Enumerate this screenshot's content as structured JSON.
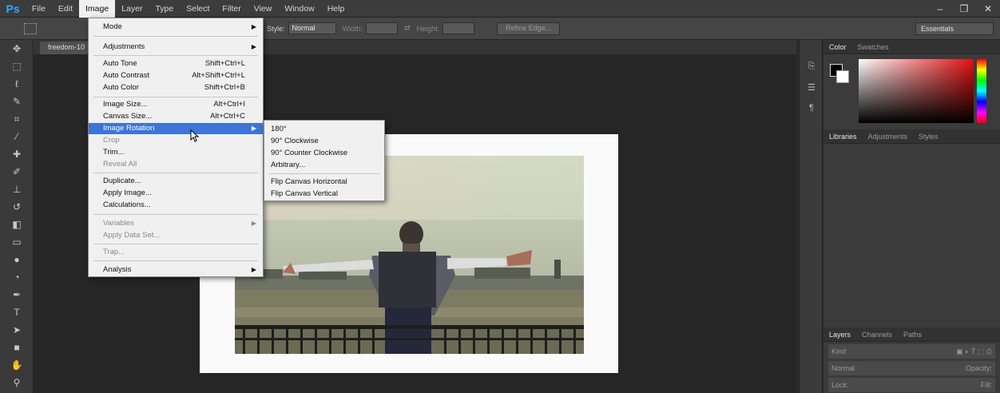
{
  "app": {
    "logo": "Ps"
  },
  "menubar": {
    "items": [
      "File",
      "Edit",
      "Image",
      "Layer",
      "Type",
      "Select",
      "Filter",
      "View",
      "Window",
      "Help"
    ],
    "active_index": 2,
    "window_controls": [
      "–",
      "❐",
      "✕"
    ]
  },
  "options_bar": {
    "style_label": "Style:",
    "style_value": "Normal",
    "width_label": "Width:",
    "height_label": "Height:",
    "refine_edge_label": "Refine Edge...",
    "workspace": "Essentials"
  },
  "document": {
    "tab_label": "freedom-10"
  },
  "image_menu": {
    "items": [
      {
        "label": "Mode",
        "submenu": true
      },
      {
        "label": "Adjustments",
        "submenu": true
      },
      {
        "label": "Auto Tone",
        "shortcut": "Shift+Ctrl+L"
      },
      {
        "label": "Auto Contrast",
        "shortcut": "Alt+Shift+Ctrl+L"
      },
      {
        "label": "Auto Color",
        "shortcut": "Shift+Ctrl+B"
      },
      {
        "label": "Image Size...",
        "shortcut": "Alt+Ctrl+I"
      },
      {
        "label": "Canvas Size...",
        "shortcut": "Alt+Ctrl+C"
      },
      {
        "label": "Image Rotation",
        "submenu": true,
        "selected": true
      },
      {
        "label": "Crop",
        "disabled": true
      },
      {
        "label": "Trim..."
      },
      {
        "label": "Reveal All",
        "disabled": true
      },
      {
        "label": "Duplicate..."
      },
      {
        "label": "Apply Image..."
      },
      {
        "label": "Calculations..."
      },
      {
        "label": "Variables",
        "submenu": true,
        "disabled": true
      },
      {
        "label": "Apply Data Set...",
        "disabled": true
      },
      {
        "label": "Trap...",
        "disabled": true
      },
      {
        "label": "Analysis",
        "submenu": true
      }
    ]
  },
  "rotation_submenu": {
    "items": [
      "180°",
      "90° Clockwise",
      "90° Counter Clockwise",
      "Arbitrary...",
      "Flip Canvas Horizontal",
      "Flip Canvas Vertical"
    ]
  },
  "panels": {
    "color_tabs": [
      "Color",
      "Swatches"
    ],
    "library_tabs": [
      "Libraries",
      "Adjustments",
      "Styles"
    ],
    "layers_tabs": [
      "Layers",
      "Channels",
      "Paths"
    ],
    "layers_kind": "Kind",
    "blend_mode": "Normal",
    "opacity_label": "Opacity:",
    "lock_label": "Lock:",
    "fill_label": "Fill:"
  },
  "colors": {
    "accent": "#31a8ff",
    "menu_highlight": "#3d74d6",
    "foreground_swatch": "#000000",
    "background_swatch": "#ffffff"
  }
}
